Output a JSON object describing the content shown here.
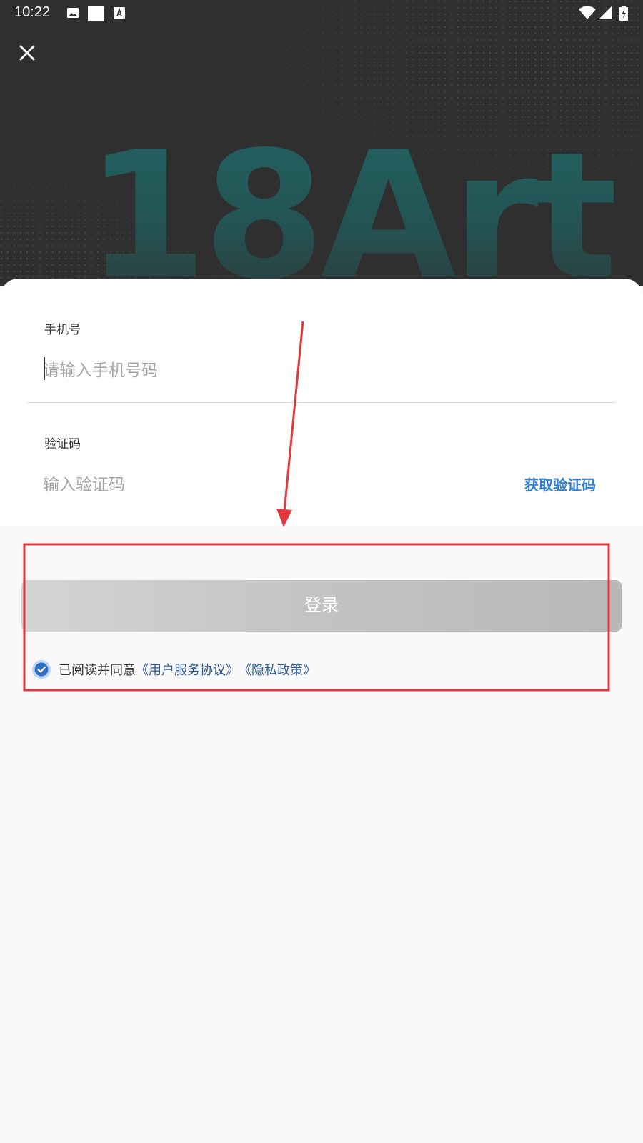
{
  "status_bar": {
    "time": "10:22",
    "icons": [
      "image-icon",
      "square-icon",
      "font-icon",
      "wifi-icon",
      "signal-icon",
      "battery-icon"
    ]
  },
  "header": {
    "close_icon": "close-icon",
    "logo_text": "18Art"
  },
  "form": {
    "phone_label": "手机号",
    "phone_placeholder": "请输入手机号码",
    "code_label": "验证码",
    "code_placeholder": "输入验证码",
    "get_code_label": "获取验证码"
  },
  "login": {
    "button_label": "登录",
    "agree_text": "已阅读并同意",
    "terms_link": "《用户服务协议》",
    "privacy_link": "《隐私政策》",
    "agree_checked": true
  },
  "colors": {
    "hero_bg": "#2f2f2f",
    "accent_blue": "#2f80d8",
    "link_blue": "#2c5a96",
    "annotation_red": "#e0393e"
  }
}
